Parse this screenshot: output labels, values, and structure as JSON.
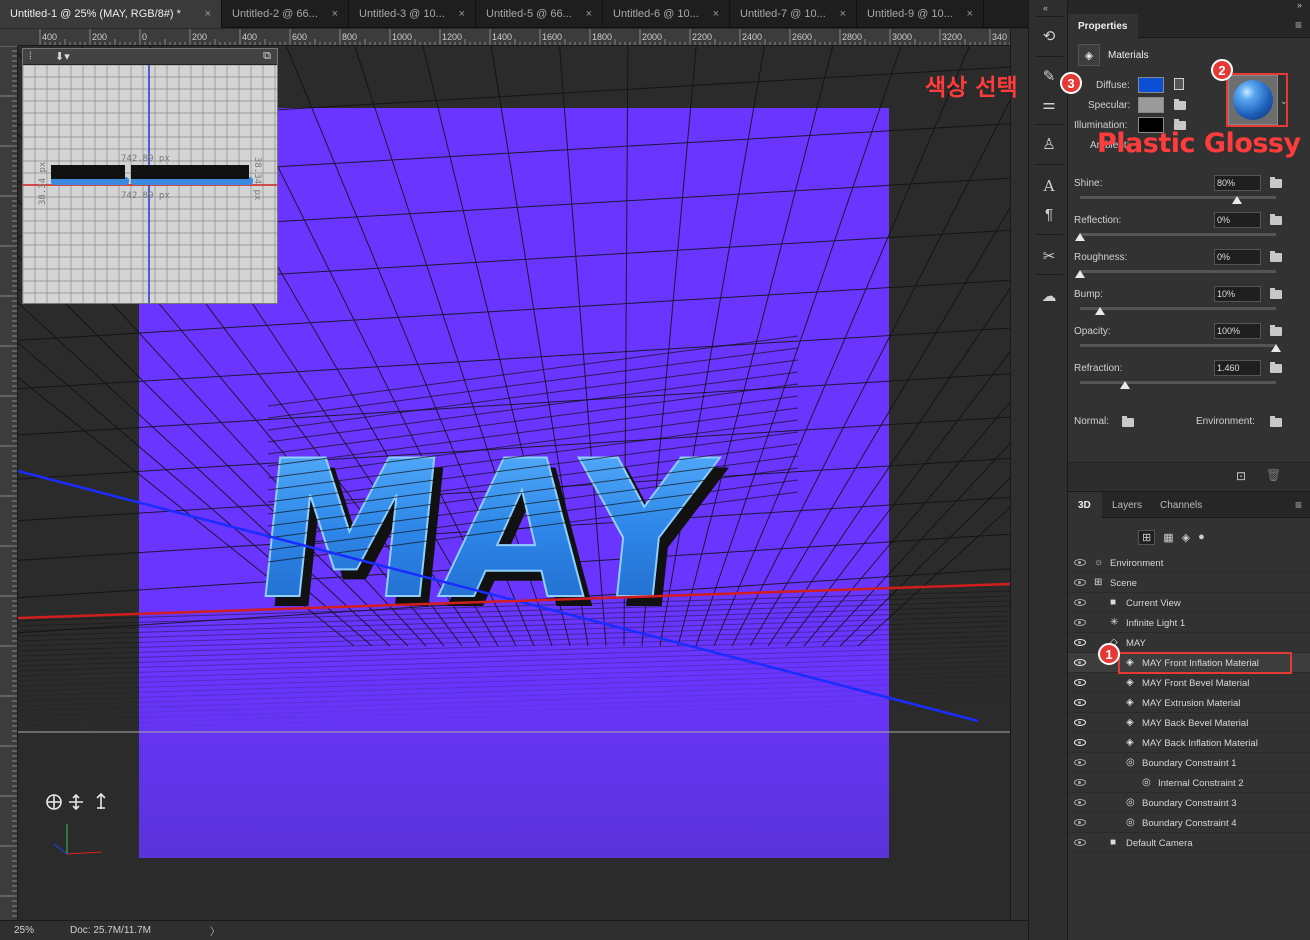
{
  "tabs": [
    {
      "label": "Untitled-1 @ 25% (MAY, RGB/8#) *",
      "active": true
    },
    {
      "label": "Untitled-2 @ 66...",
      "active": false
    },
    {
      "label": "Untitled-3 @ 10...",
      "active": false
    },
    {
      "label": "Untitled-5 @ 66...",
      "active": false
    },
    {
      "label": "Untitled-6 @ 10...",
      "active": false
    },
    {
      "label": "Untitled-7 @ 10...",
      "active": false
    },
    {
      "label": "Untitled-9 @ 10...",
      "active": false
    }
  ],
  "tab_close": "×",
  "ruler_top_labels": [
    "400",
    "200",
    "0",
    "200",
    "400",
    "600",
    "800",
    "1000",
    "1200",
    "1400",
    "1600",
    "1800",
    "2000",
    "2200",
    "2400",
    "2600",
    "2800",
    "3000",
    "3200",
    "340"
  ],
  "navigator": {
    "measure_top": "742.89 px",
    "measure_bottom": "742.89 px",
    "measure_left": "38.34 px",
    "measure_right": "38.34 px"
  },
  "canvas": {
    "text": "MAY",
    "background_color": "#6a35ff",
    "text_color": "#3a9cf0"
  },
  "status": {
    "zoom": "25%",
    "doc": "Doc: 25.7M/11.7M",
    "arrow": "〉"
  },
  "properties": {
    "panel_title": "Properties",
    "section": "Materials",
    "diffuse_label": "Diffuse:",
    "diffuse_color": "#0a4fd6",
    "specular_label": "Specular:",
    "specular_color": "#9a9a9a",
    "illumination_label": "Illumination:",
    "illumination_color": "#000000",
    "ambient_label": "Ambient:",
    "sliders": [
      {
        "label": "Shine:",
        "value": "80%",
        "level": 0.8
      },
      {
        "label": "Reflection:",
        "value": "0%",
        "level": 0
      },
      {
        "label": "Roughness:",
        "value": "0%",
        "level": 0
      },
      {
        "label": "Bump:",
        "value": "10%",
        "level": 0.1
      },
      {
        "label": "Opacity:",
        "value": "100%",
        "level": 1.0
      },
      {
        "label": "Refraction:",
        "value": "1.460",
        "level": 0.23
      }
    ],
    "normal_label": "Normal:",
    "environment_label": "Environment:"
  },
  "annotations": {
    "badge1": "1",
    "badge2": "2",
    "badge3": "3",
    "color_select": "색상 선택",
    "plastic_glossy": "Plastic Glossy"
  },
  "bottom_tabs": [
    "3D",
    "Layers",
    "Channels"
  ],
  "layers": [
    {
      "name": "Environment",
      "icon": "environment-icon",
      "indent": 0,
      "eye": false
    },
    {
      "name": "Scene",
      "icon": "scene-icon",
      "indent": 0,
      "eye": false
    },
    {
      "name": "Current View",
      "icon": "camera-icon",
      "indent": 1,
      "eye": false
    },
    {
      "name": "Infinite Light 1",
      "icon": "light-icon",
      "indent": 1,
      "eye": false
    },
    {
      "name": "MAY",
      "icon": "mesh-icon",
      "indent": 1,
      "eye": true
    },
    {
      "name": "MAY Front Inflation Material",
      "icon": "material-icon",
      "indent": 2,
      "eye": true,
      "selected": true
    },
    {
      "name": "MAY Front Bevel Material",
      "icon": "material-icon",
      "indent": 2,
      "eye": true
    },
    {
      "name": "MAY Extrusion Material",
      "icon": "material-icon",
      "indent": 2,
      "eye": true
    },
    {
      "name": "MAY Back Bevel Material",
      "icon": "material-icon",
      "indent": 2,
      "eye": true
    },
    {
      "name": "MAY Back Inflation Material",
      "icon": "material-icon",
      "indent": 2,
      "eye": true
    },
    {
      "name": "Boundary Constraint 1",
      "icon": "constraint-icon",
      "indent": 2,
      "eye": false
    },
    {
      "name": "Internal Constraint 2",
      "icon": "constraint-icon",
      "indent": 3,
      "eye": false
    },
    {
      "name": "Boundary Constraint 3",
      "icon": "constraint-icon",
      "indent": 2,
      "eye": false
    },
    {
      "name": "Boundary Constraint 4",
      "icon": "constraint-icon",
      "indent": 2,
      "eye": false
    },
    {
      "name": "Default Camera",
      "icon": "camera-icon",
      "indent": 1,
      "eye": false
    }
  ]
}
